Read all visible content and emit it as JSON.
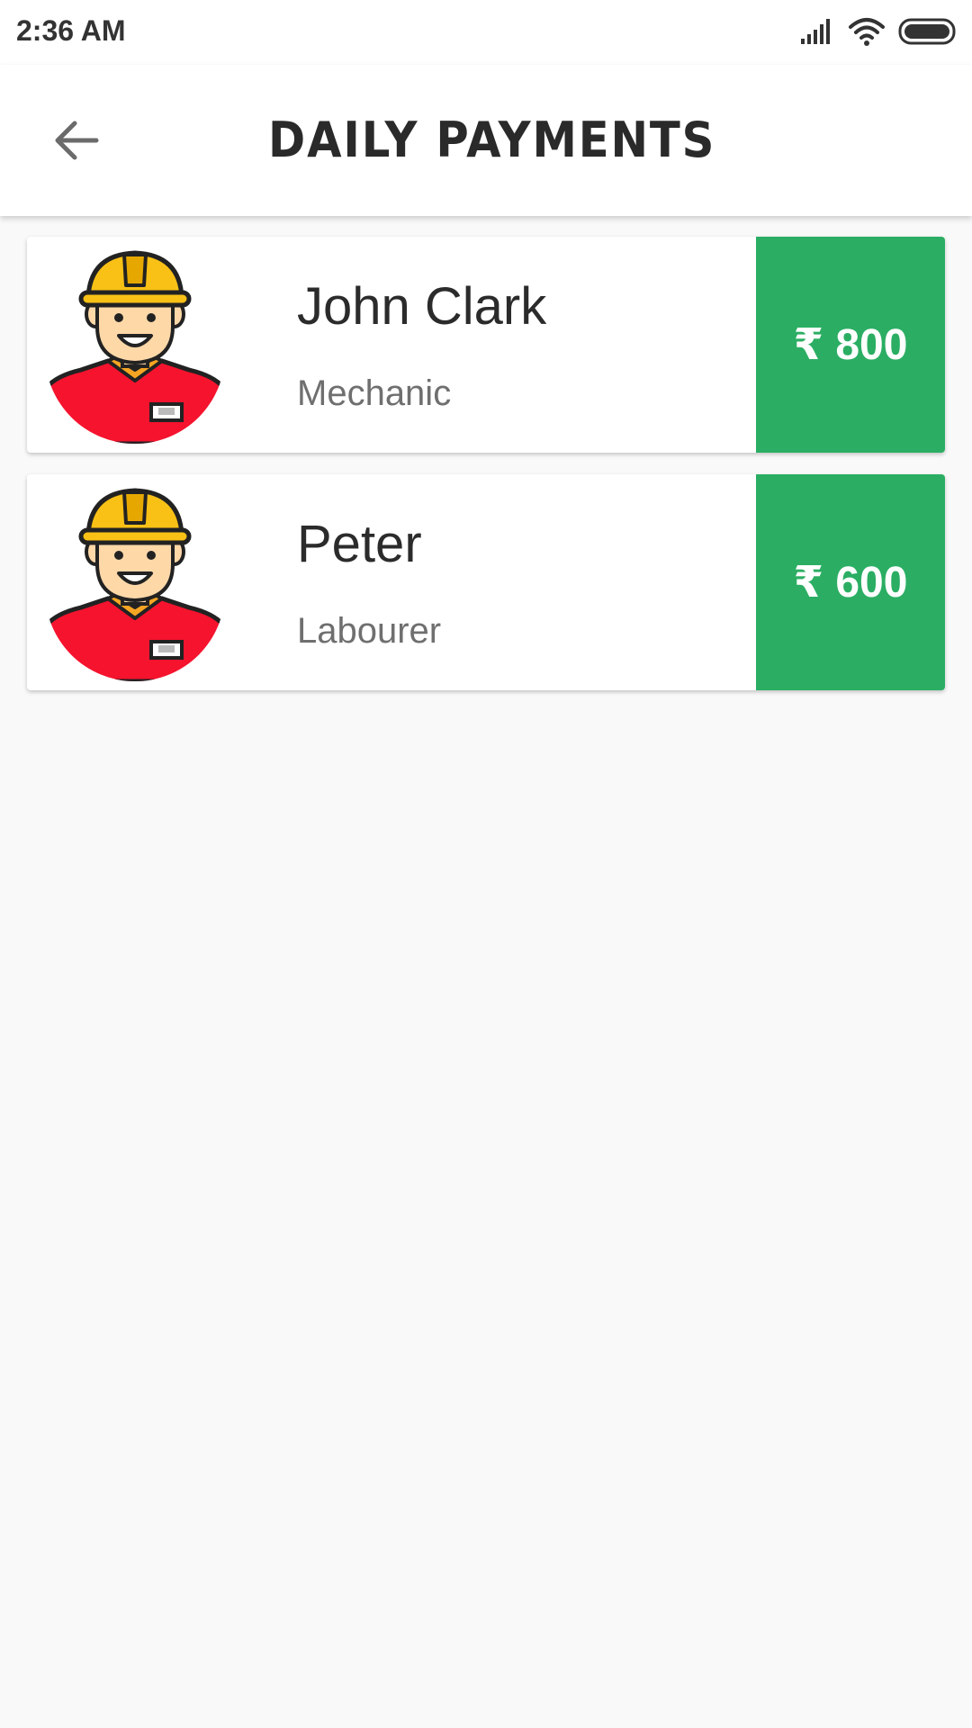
{
  "status_bar": {
    "time": "2:36 AM",
    "icons": [
      "signal-icon",
      "wifi-icon",
      "battery-icon"
    ]
  },
  "header": {
    "back_icon": "back-arrow-icon",
    "title": "DAILY PAYMENTS"
  },
  "workers": [
    {
      "name": "John Clark",
      "role": "Mechanic",
      "amount": "₹ 800",
      "avatar_icon": "worker-avatar-icon"
    },
    {
      "name": "Peter",
      "role": "Labourer",
      "amount": "₹ 600",
      "avatar_icon": "worker-avatar-icon"
    }
  ],
  "colors": {
    "amount_bg": "#2bae63",
    "helmet": "#f9c016",
    "shirt": "#f5132e",
    "background": "#f9f9f9"
  }
}
